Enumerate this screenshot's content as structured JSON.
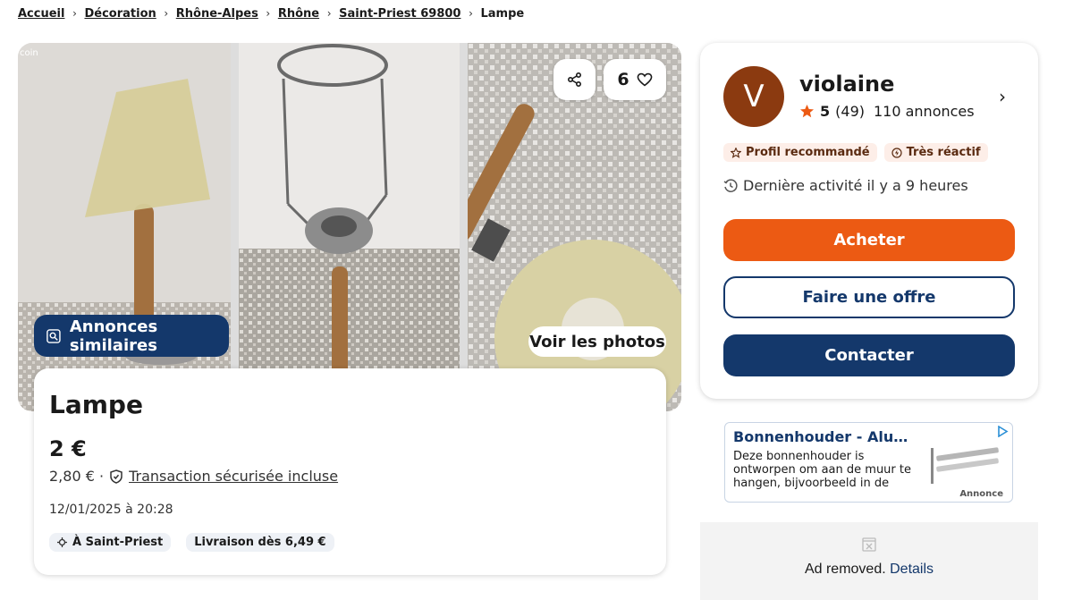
{
  "breadcrumb": [
    "Accueil",
    "Décoration",
    "Rhône-Alpes",
    "Rhône",
    "Saint-Priest 69800",
    "Lampe"
  ],
  "gallery": {
    "watermark": "coin",
    "favorites_count": "6",
    "similar_label": "Annonces similaires",
    "photos_label": "Voir les photos"
  },
  "listing": {
    "title": "Lampe",
    "price": "2 €",
    "protected_price": "2,80 € ·",
    "protection_label": "Transaction sécurisée incluse",
    "date": "12/01/2025 à 20:28",
    "location": "À Saint-Priest",
    "delivery": "Livraison dès 6,49 €"
  },
  "seller": {
    "initial": "V",
    "name": "violaine",
    "rating": "5",
    "reviews": "(49)",
    "listings": "110 annonces",
    "badge_recommended": "Profil recommandé",
    "badge_reactive": "Très réactif",
    "last_activity": "Dernière activité il y a 9 heures",
    "buy_label": "Acheter",
    "offer_label": "Faire une offre",
    "contact_label": "Contacter"
  },
  "ad": {
    "title": "Bonnenhouder - Aluminium...",
    "text": "Deze bonnenhouder is ontworpen om aan de muur te hangen, bijvoorbeeld in de keuken of in...",
    "label": "Annonce"
  },
  "ad_removed": {
    "message": "Ad removed.",
    "details": "Details"
  },
  "colors": {
    "primary": "#14386b",
    "accent": "#ec5a13",
    "avatar": "#8b3a10",
    "star": "#ec5a13"
  }
}
